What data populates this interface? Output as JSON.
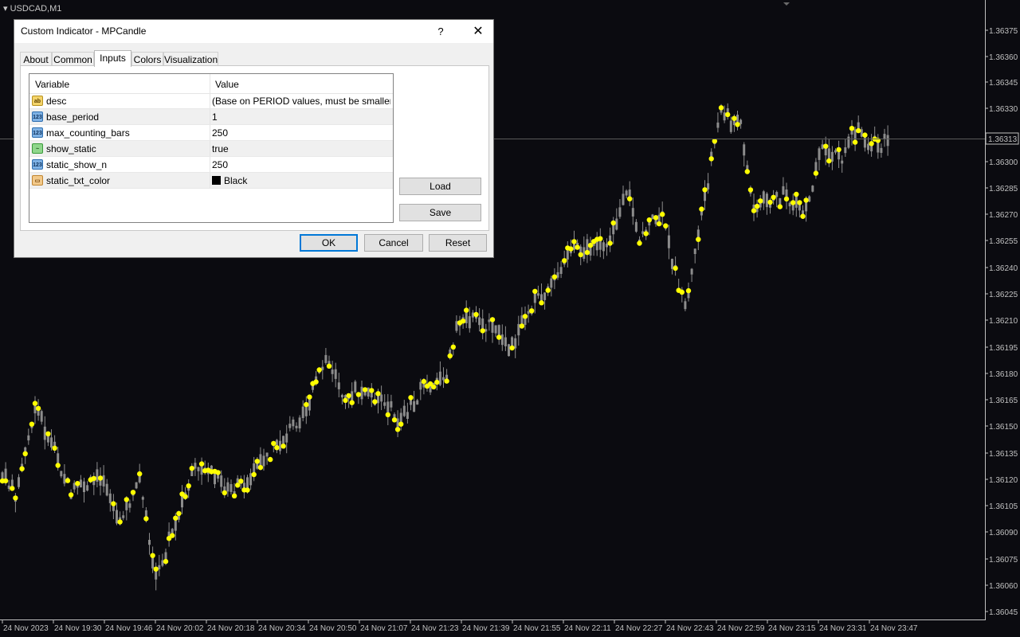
{
  "chart": {
    "symbol": "USDCAD,M1",
    "current_price": "1.36313",
    "price_labels": [
      "1.36375",
      "1.36360",
      "1.36345",
      "1.36330",
      "1.36300",
      "1.36285",
      "1.36270",
      "1.36255",
      "1.36240",
      "1.36225",
      "1.36210",
      "1.36195",
      "1.36180",
      "1.36165",
      "1.36150",
      "1.36135",
      "1.36120",
      "1.36105",
      "1.36090",
      "1.36075",
      "1.36060",
      "1.36045"
    ],
    "time_labels": [
      "24 Nov 2023",
      "24 Nov 19:30",
      "24 Nov 19:46",
      "24 Nov 20:02",
      "24 Nov 20:18",
      "24 Nov 20:34",
      "24 Nov 20:50",
      "24 Nov 21:07",
      "24 Nov 21:23",
      "24 Nov 21:39",
      "24 Nov 21:55",
      "24 Nov 22:11",
      "24 Nov 22:27",
      "24 Nov 22:43",
      "24 Nov 22:59",
      "24 Nov 23:15",
      "24 Nov 23:31",
      "24 Nov 23:47"
    ],
    "colors": {
      "background": "#0b0b10",
      "candle": "#8c8c8c",
      "marker": "#ffff00",
      "text": "#c0c0c0"
    }
  },
  "dialog": {
    "title": "Custom Indicator - MPCandle",
    "help_label": "?",
    "close_label": "✕",
    "tabs": [
      {
        "label": "About"
      },
      {
        "label": "Common"
      },
      {
        "label": "Inputs"
      },
      {
        "label": "Colors"
      },
      {
        "label": "Visualization"
      }
    ],
    "active_tab": "Inputs",
    "table": {
      "headers": {
        "variable": "Variable",
        "value": "Value"
      },
      "rows": [
        {
          "icon": "ab",
          "variable": "desc",
          "value": "(Base on PERIOD values, must be smaller th..."
        },
        {
          "icon": "123",
          "variable": "base_period",
          "value": "1"
        },
        {
          "icon": "123",
          "variable": "max_counting_bars",
          "value": "250"
        },
        {
          "icon": "~",
          "variable": "show_static",
          "value": "true"
        },
        {
          "icon": "123",
          "variable": "static_show_n",
          "value": "250"
        },
        {
          "icon": "▭",
          "variable": "static_txt_color",
          "value": "Black"
        }
      ]
    },
    "buttons": {
      "load": "Load",
      "save": "Save",
      "ok": "OK",
      "cancel": "Cancel",
      "reset": "Reset"
    }
  }
}
